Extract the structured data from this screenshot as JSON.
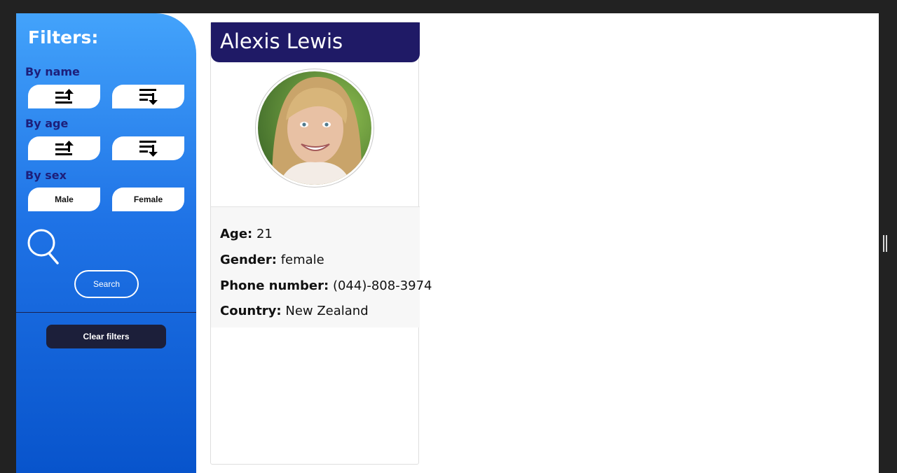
{
  "sidebar": {
    "title": "Filters:",
    "sections": {
      "name": {
        "label": "By name",
        "asc_icon": "sort-ascending-icon",
        "desc_icon": "sort-descending-icon"
      },
      "age": {
        "label": "By age",
        "asc_icon": "sort-ascending-icon",
        "desc_icon": "sort-descending-icon"
      },
      "sex": {
        "label": "By sex",
        "male_label": "Male",
        "female_label": "Female"
      }
    },
    "search_icon": "magnifier-icon",
    "search_label": "Search",
    "clear_label": "Clear filters"
  },
  "profile": {
    "name": "Alexis Lewis",
    "age_label": "Age:",
    "age": "21",
    "gender_label": "Gender:",
    "gender": "female",
    "phone_label": "Phone number:",
    "phone": "(044)-808-3974",
    "country_label": "Country:",
    "country": "New Zealand"
  },
  "colors": {
    "sidebar_top": "#43a3fb",
    "sidebar_bottom": "#0854cc",
    "section_label": "#1d1f7a",
    "card_header": "#1f1a66",
    "clear_button": "#1c1f3a"
  }
}
